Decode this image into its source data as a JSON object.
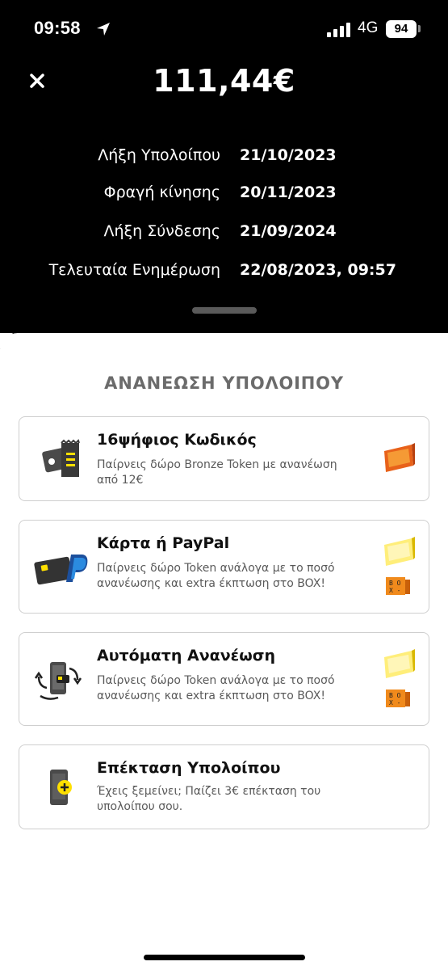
{
  "status_bar": {
    "time": "09:58",
    "network": "4G",
    "battery": "94"
  },
  "header": {
    "balance": "111,44€"
  },
  "info": [
    {
      "label": "Λήξη Υπολοίπου",
      "value": "21/10/2023"
    },
    {
      "label": "Φραγή κίνησης",
      "value": "20/11/2023"
    },
    {
      "label": "Λήξη Σύνδεσης",
      "value": "21/09/2024"
    },
    {
      "label": "Τελευταία Ενημέρωση",
      "value": "22/08/2023, 09:57"
    }
  ],
  "section_title": "ΑΝΑΝΕΩΣΗ ΥΠΟΛΟΙΠΟΥ",
  "options": [
    {
      "title": "16ψήφιος Κωδικός",
      "description": "Παίρνεις δώρο Bronze Token με ανανέωση από 12€",
      "icon": "voucher-code-icon",
      "badge": "bronze-token-icon"
    },
    {
      "title": "Κάρτα ή PayPal",
      "description": "Παίρνεις δώρο Token ανάλογα με το ποσό ανανέωσης και extra έκπτωση στο BOX!",
      "icon": "card-paypal-icon",
      "badge": "gold-token-icon",
      "box_badge": "box-icon"
    },
    {
      "title": "Αυτόματη Ανανέωση",
      "description": "Παίρνεις δώρο Token ανάλογα με το ποσό ανανέωσης και extra έκπτωση στο BOX!",
      "icon": "auto-renew-icon",
      "badge": "gold-token-icon",
      "box_badge": "box-icon"
    },
    {
      "title": "Επέκταση Υπολοίπου",
      "description": "Έχεις ξεμείνει; Παίζει 3€ επέκταση του υπολοίπου σου.",
      "icon": "extend-balance-icon"
    }
  ],
  "colors": {
    "accent_yellow": "#FFE000",
    "bronze": "#E8621A",
    "box_orange": "#F08A1C",
    "text_muted": "#5A5A5A"
  }
}
